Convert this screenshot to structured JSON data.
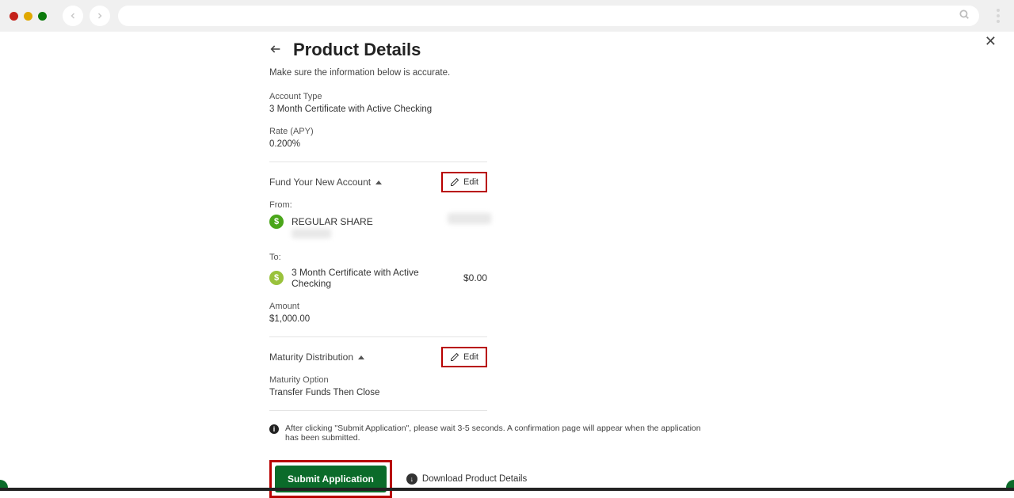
{
  "header": {
    "title": "Product Details",
    "subtitle": "Make sure the information below is accurate."
  },
  "accountType": {
    "label": "Account Type",
    "value": "3 Month Certificate with Active Checking"
  },
  "rate": {
    "label": "Rate (APY)",
    "value": "0.200%"
  },
  "fund": {
    "title": "Fund Your New Account",
    "edit": "Edit",
    "fromLabel": "From:",
    "fromName": "REGULAR SHARE",
    "toLabel": "To:",
    "toName": "3 Month Certificate with Active Checking",
    "toBalance": "$0.00",
    "amountLabel": "Amount",
    "amountValue": "$1,000.00"
  },
  "maturity": {
    "title": "Maturity Distribution",
    "edit": "Edit",
    "optionLabel": "Maturity Option",
    "optionValue": "Transfer Funds Then Close"
  },
  "info": "After clicking \"Submit Application\", please wait 3-5 seconds. A confirmation page will appear when the application has been submitted.",
  "actions": {
    "submit": "Submit Application",
    "download": "Download Product Details"
  }
}
